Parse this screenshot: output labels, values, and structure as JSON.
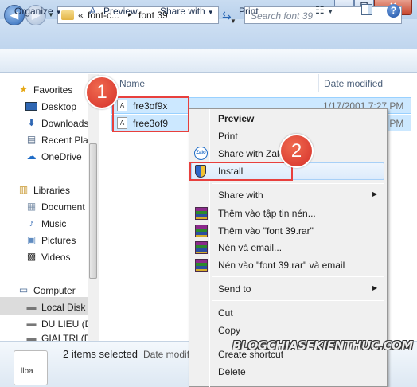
{
  "window": {
    "min_glyph": "▁",
    "max_glyph": "☐",
    "close_glyph": "✕"
  },
  "address": {
    "chevron": "«",
    "crumbs": [
      "font-c...",
      "font 39"
    ],
    "separator": "▸"
  },
  "search": {
    "placeholder": "Search font 39"
  },
  "toolbar": {
    "organize": "Organize",
    "preview": "Preview",
    "share_with": "Share with",
    "print": "Print",
    "help": "?"
  },
  "nav": {
    "favorites": "Favorites",
    "desktop": "Desktop",
    "downloads": "Downloads",
    "recent": "Recent Plac",
    "onedrive": "OneDrive",
    "libraries": "Libraries",
    "documents": "Document",
    "music": "Music",
    "pictures": "Pictures",
    "videos": "Videos",
    "computer": "Computer",
    "local_disk": "Local Disk",
    "du_lieu": "DU LIEU (D",
    "giai_tri": "GIAI TRI (E"
  },
  "columns": {
    "name": "Name",
    "date_modified": "Date modified"
  },
  "files": [
    {
      "name": "fre3of9x",
      "date": "1/17/2001 7:27 PM"
    },
    {
      "name": "free3of9",
      "date": "1/17/2001 7:27 PM"
    }
  ],
  "status": {
    "thumb_label": "llba",
    "count": "2 items selected",
    "date_label": "Date modifi"
  },
  "context_menu": {
    "preview": "Preview",
    "print": "Print",
    "share_zalo": "Share with Zalo",
    "install": "Install",
    "share_with": "Share with",
    "add_archive": "Thêm vào tập tin nén...",
    "add_rar": "Thêm vào \"font 39.rar\"",
    "compress_email": "Nén và email...",
    "compress_rar_email": "Nén vào \"font 39.rar\" và email",
    "send_to": "Send to",
    "cut": "Cut",
    "copy": "Copy",
    "create_shortcut": "Create shortcut",
    "delete": "Delete",
    "zalo_icon_text": "Zalo"
  },
  "annotations": {
    "step1": "1",
    "step2": "2"
  },
  "watermark": "BLOGCHIASEKIENTHUC.COM",
  "colors": {
    "highlight_red": "#e8403d",
    "selection_blue": "#cce8ff",
    "badge_red": "#d6302a"
  }
}
